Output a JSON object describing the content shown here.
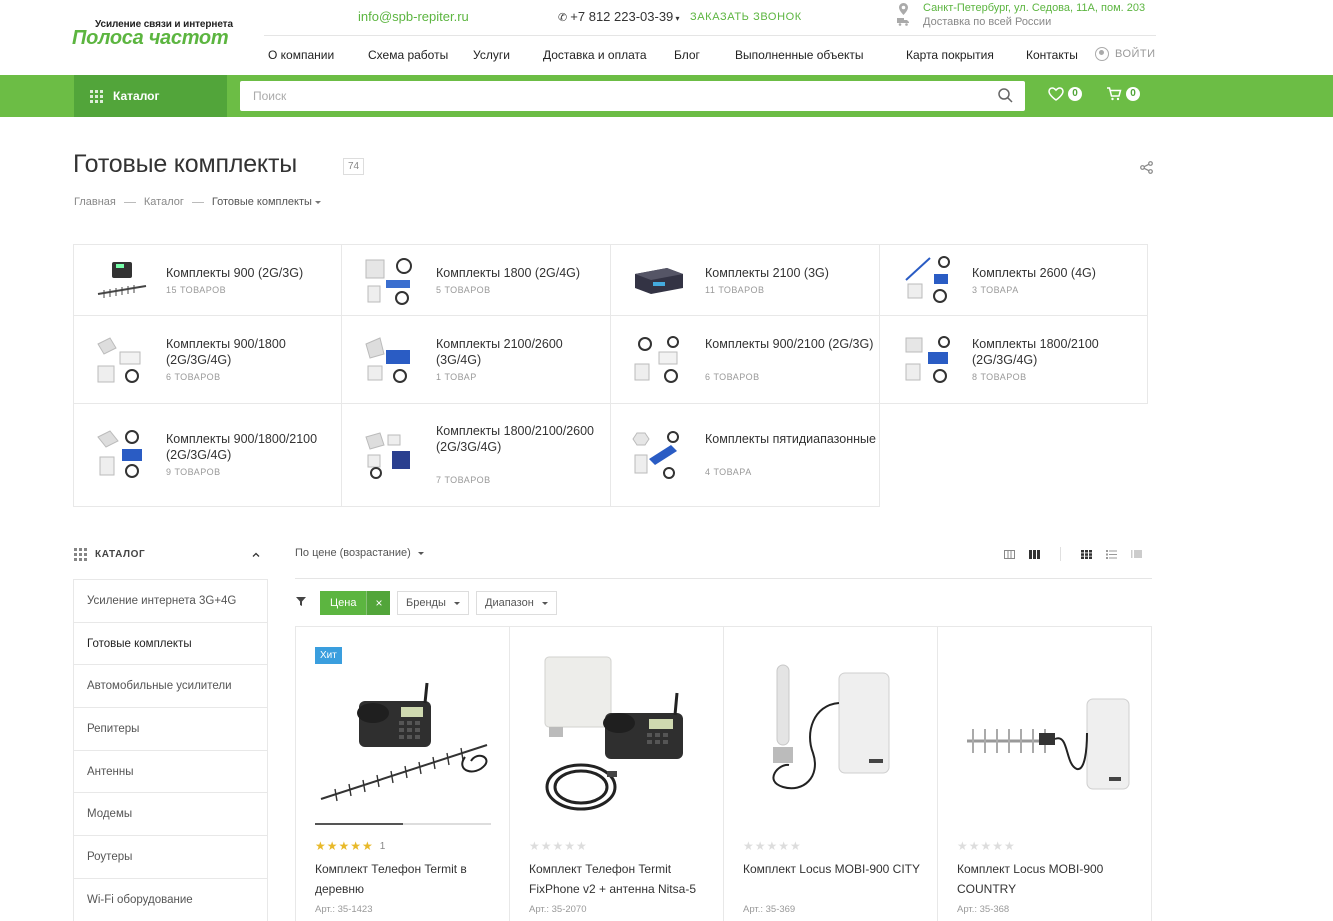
{
  "header": {
    "logo_tagline": "Усиление связи и интернета",
    "logo_name": "Полоса частот",
    "email": "info@spb-repiter.ru",
    "phone": "+7 812 223-03-39",
    "callback": "ЗАКАЗАТЬ ЗВОНОК",
    "address": "Санкт-Петербург, ул. Седова, 11А, пом. 203",
    "delivery": "Доставка по всей России",
    "login": "ВОЙТИ"
  },
  "nav": [
    "О компании",
    "Схема работы",
    "Услуги",
    "Доставка и оплата",
    "Блог",
    "Выполненные объекты",
    "Карта покрытия",
    "Контакты"
  ],
  "bar": {
    "catalog": "Каталог",
    "search_placeholder": "Поиск",
    "favorites_count": "0",
    "cart_count": "0"
  },
  "page": {
    "title": "Готовые комплекты",
    "count": "74",
    "breadcrumb": [
      "Главная",
      "Каталог",
      "Готовые комплекты"
    ]
  },
  "subcategories": [
    {
      "title": "Комплекты 900 (2G/3G)",
      "count": "15 ТОВАРОВ"
    },
    {
      "title": "Комплекты 1800 (2G/4G)",
      "count": "5 ТОВАРОВ"
    },
    {
      "title": "Комплекты 2100 (3G)",
      "count": "11 ТОВАРОВ"
    },
    {
      "title": "Комплекты 2600 (4G)",
      "count": "3 ТОВАРА"
    },
    {
      "title": "Комплекты 900/1800 (2G/3G/4G)",
      "count": "6 ТОВАРОВ"
    },
    {
      "title": "Комплекты 2100/2600 (3G/4G)",
      "count": "1 ТОВАР"
    },
    {
      "title": "Комплекты 900/2100 (2G/3G)",
      "count": "6 ТОВАРОВ"
    },
    {
      "title": "Комплекты 1800/2100 (2G/3G/4G)",
      "count": "8 ТОВАРОВ"
    },
    {
      "title": "Комплекты 900/1800/2100 (2G/3G/4G)",
      "count": "9 ТОВАРОВ"
    },
    {
      "title": "Комплекты 1800/2100/2600 (2G/3G/4G)",
      "count": "7 ТОВАРОВ"
    },
    {
      "title": "Комплекты пятидиапазонные",
      "count": "4 ТОВАРА"
    }
  ],
  "sidebar": {
    "heading": "КАТАЛОГ",
    "items": [
      "Усиление интернета 3G+4G",
      "Готовые комплекты",
      "Автомобильные усилители",
      "Репитеры",
      "Антенны",
      "Модемы",
      "Роутеры",
      "Wi-Fi оборудование"
    ],
    "active_index": 1
  },
  "toolbar": {
    "sort": "По цене (возрастание)",
    "filter_price": "Цена",
    "filter_price_remove": "×",
    "filter_brands": "Бренды",
    "filter_range": "Диапазон"
  },
  "products": [
    {
      "badge": "Хит",
      "rating": 5,
      "reviews": "1",
      "name": "Комплект Телефон Termit в деревню",
      "article": "Арт.: 35-1423",
      "gallery_images": 2
    },
    {
      "badge": "",
      "rating": 0,
      "reviews": "",
      "name": "Комплект Телефон Termit FixPhone v2 + антенна Nitsa-5",
      "article": "Арт.: 35-2070",
      "gallery_images": 1
    },
    {
      "badge": "",
      "rating": 0,
      "reviews": "",
      "name": "Комплект Locus MOBI-900 CITY",
      "article": "Арт.: 35-369",
      "gallery_images": 1
    },
    {
      "badge": "",
      "rating": 0,
      "reviews": "",
      "name": "Комплект Locus MOBI-900 COUNTRY",
      "article": "Арт.: 35-368",
      "gallery_images": 1
    }
  ],
  "colors": {
    "brand_green": "#6cbd45",
    "dark_green": "#52a53a",
    "hit_badge": "#3a9ede",
    "star": "#e8b92a"
  }
}
